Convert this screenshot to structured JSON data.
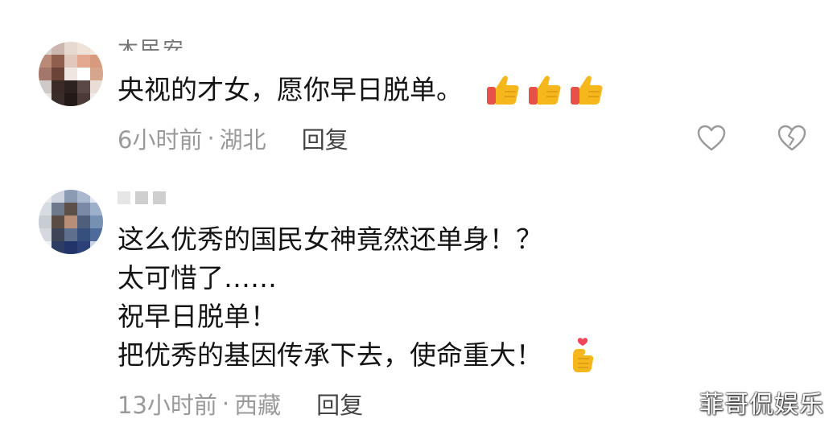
{
  "comments": [
    {
      "username_visible": "木民安",
      "lines": [
        "央视的才女，愿你早日脱单。"
      ],
      "emoji": [
        "thumbs-up-icon",
        "thumbs-up-icon",
        "thumbs-up-icon"
      ],
      "time": "6小时前",
      "separator": "·",
      "location": "湖北",
      "reply_label": "回复"
    },
    {
      "lines": [
        "这么优秀的国民女神竟然还单身！？",
        "太可惜了……",
        "祝早日脱单！",
        "把优秀的基因传承下去，使命重大！"
      ],
      "emoji": [
        "finger-heart-icon"
      ],
      "time": "13小时前",
      "separator": "·",
      "location": "西藏",
      "reply_label": "回复"
    }
  ],
  "watermark": "菲哥侃娱乐",
  "colors": {
    "text": "#141414",
    "meta": "#9a9a9a",
    "thumb_yellow": "#f5b71b",
    "cuff_red": "#e8504a"
  }
}
